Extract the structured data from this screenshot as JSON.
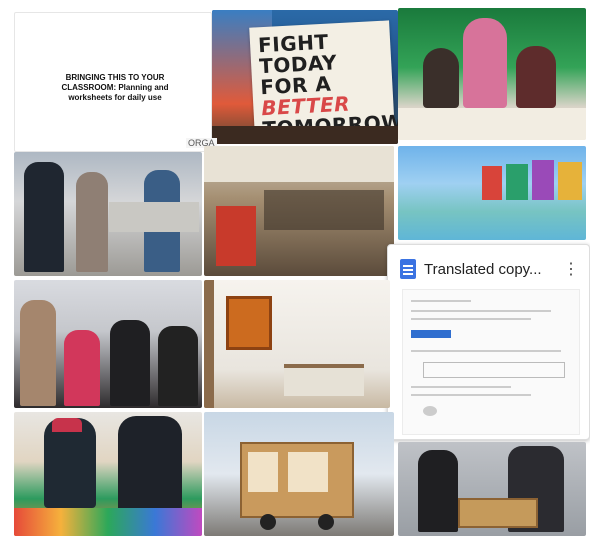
{
  "tile1": {
    "text": "BRINGING THIS TO YOUR CLASSROOM: Planning and worksheets for daily use"
  },
  "sign": {
    "line1": "FIGHT TODAY",
    "line2_prefix": "FOR A",
    "line2_accent": "BETTER",
    "line3": "TOMORROW"
  },
  "label_tab": "ORGA",
  "doc_card": {
    "title": "Translated copy...",
    "menu_glyph": "⋮"
  },
  "icons": {
    "doc": "doc-icon",
    "menu": "kebab-menu-icon"
  },
  "colors": {
    "doc_blue": "#3b73e2",
    "sign_red": "#d94848"
  }
}
